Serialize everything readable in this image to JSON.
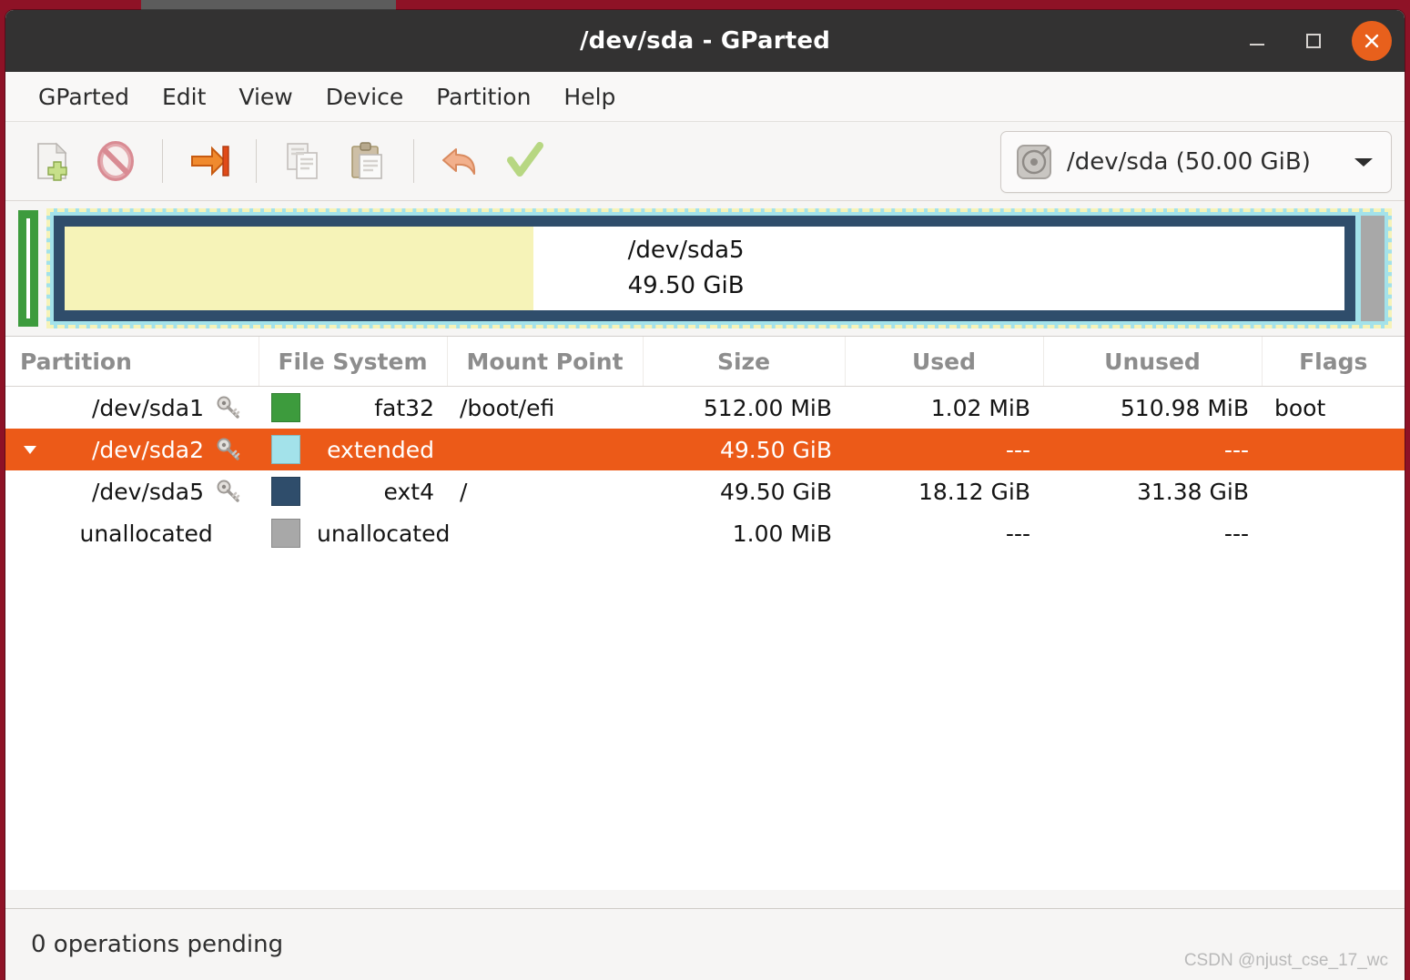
{
  "window": {
    "title": "/dev/sda - GParted",
    "controls": {
      "minimize": "minimize-button",
      "maximize": "maximize-button",
      "close": "close-button"
    }
  },
  "menubar": {
    "items": [
      {
        "label": "GParted"
      },
      {
        "label": "Edit"
      },
      {
        "label": "View"
      },
      {
        "label": "Device"
      },
      {
        "label": "Partition"
      },
      {
        "label": "Help"
      }
    ]
  },
  "toolbar": {
    "buttons": [
      {
        "icon": "new-partition-icon",
        "name": "new-partition-button"
      },
      {
        "icon": "delete-partition-icon",
        "name": "delete-partition-button"
      },
      {
        "icon": "resize-move-icon",
        "name": "resize-move-button"
      },
      {
        "icon": "copy-icon",
        "name": "copy-button"
      },
      {
        "icon": "paste-icon",
        "name": "paste-button"
      },
      {
        "icon": "undo-icon",
        "name": "undo-button"
      },
      {
        "icon": "apply-checkmark-icon",
        "name": "apply-button"
      }
    ],
    "device_selector": {
      "label": "/dev/sda (50.00 GiB)",
      "icon": "harddisk-icon",
      "chevron": "chevron-down-icon"
    }
  },
  "disk_graphic": {
    "partitions": [
      {
        "name": "/dev/sda1",
        "color": "#3d9b3d",
        "label": "",
        "size_label": ""
      },
      {
        "name": "/dev/sda2",
        "color": "#a3e2ea",
        "label": "",
        "size_label": "",
        "selected": true
      },
      {
        "name": "/dev/sda5",
        "color": "#2f4d6b",
        "label": "/dev/sda5",
        "size_label": "49.50 GiB"
      },
      {
        "name": "unallocated",
        "color": "#a8a8a8",
        "label": "",
        "size_label": ""
      }
    ]
  },
  "table": {
    "columns": [
      "Partition",
      "File System",
      "Mount Point",
      "Size",
      "Used",
      "Unused",
      "Flags"
    ],
    "rows": [
      {
        "partition": "/dev/sda1",
        "has_key": true,
        "has_expander": false,
        "indent": 0,
        "fs_color": "#3d9b3d",
        "filesystem": "fat32",
        "mount_point": "/boot/efi",
        "size": "512.00 MiB",
        "used": "1.02 MiB",
        "unused": "510.98 MiB",
        "flags": "boot",
        "selected": false
      },
      {
        "partition": "/dev/sda2",
        "has_key": true,
        "has_expander": true,
        "expander_icon": "triangle-down-icon",
        "indent": 0,
        "fs_color": "#a3e2ea",
        "filesystem": "extended",
        "mount_point": "",
        "size": "49.50 GiB",
        "used": "---",
        "unused": "---",
        "flags": "",
        "selected": true
      },
      {
        "partition": "/dev/sda5",
        "has_key": true,
        "has_expander": false,
        "indent": 1,
        "fs_color": "#2f4d6b",
        "filesystem": "ext4",
        "mount_point": "/",
        "size": "49.50 GiB",
        "used": "18.12 GiB",
        "unused": "31.38 GiB",
        "flags": "",
        "selected": false
      },
      {
        "partition": "unallocated",
        "has_key": false,
        "has_expander": false,
        "indent": 1,
        "fs_color": "#a8a8a8",
        "filesystem": "unallocated",
        "mount_point": "",
        "size": "1.00 MiB",
        "used": "---",
        "unused": "---",
        "flags": "",
        "selected": false
      }
    ]
  },
  "statusbar": {
    "text": "0 operations pending"
  },
  "watermark": {
    "text": "CSDN @njust_cse_17_wc"
  }
}
